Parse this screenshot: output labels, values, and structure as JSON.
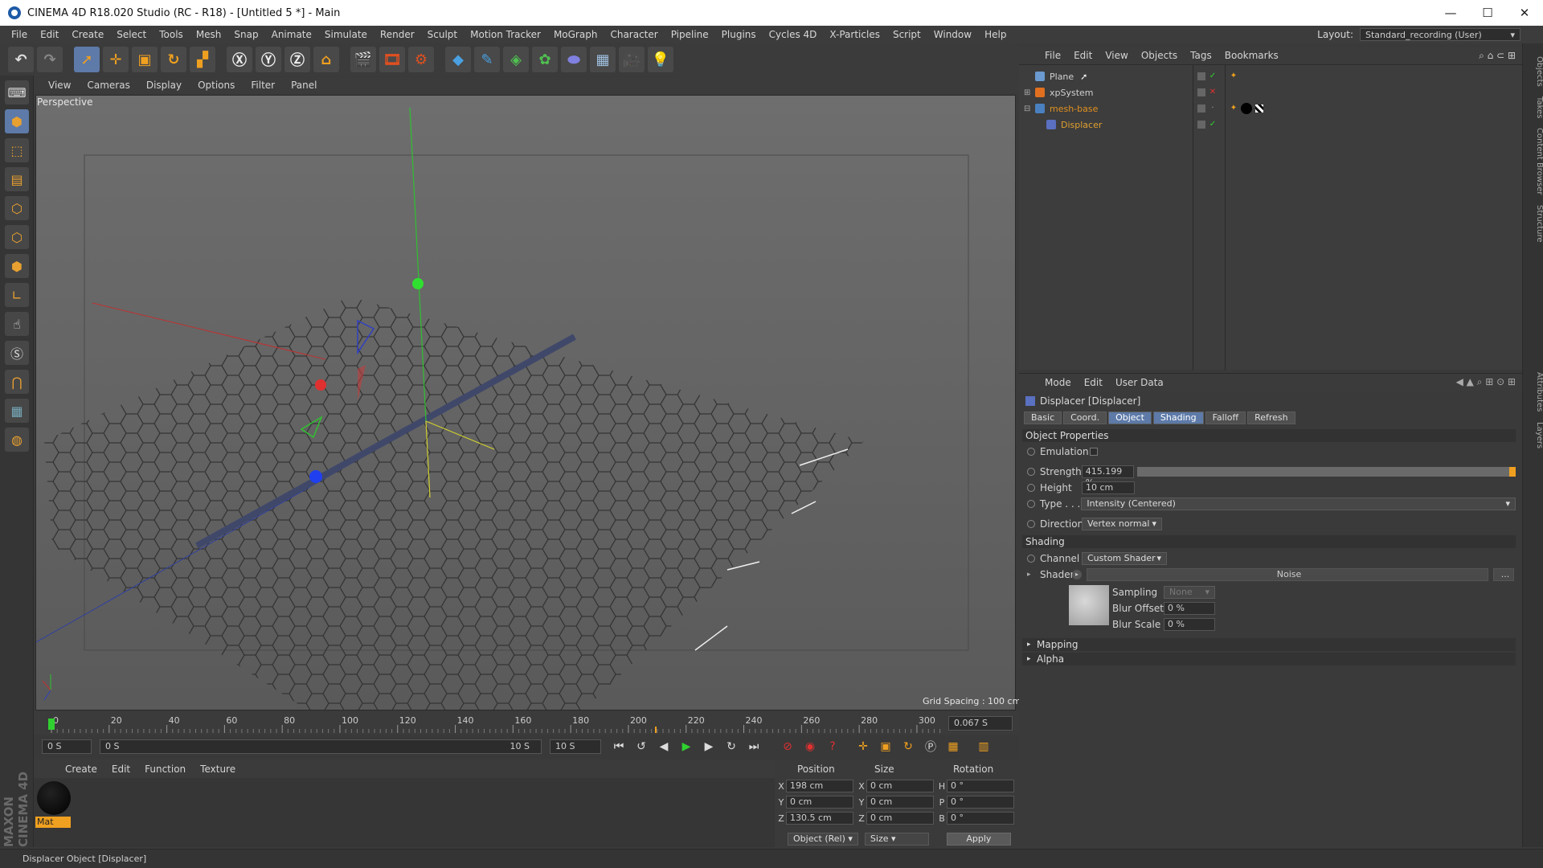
{
  "window": {
    "title": "CINEMA 4D R18.020 Studio (RC - R18) - [Untitled 5 *] - Main",
    "min": "—",
    "max": "☐",
    "close": "✕"
  },
  "menu": [
    "File",
    "Edit",
    "Create",
    "Select",
    "Tools",
    "Mesh",
    "Snap",
    "Animate",
    "Simulate",
    "Render",
    "Sculpt",
    "Motion Tracker",
    "MoGraph",
    "Character",
    "Pipeline",
    "Plugins",
    "Cycles 4D",
    "X-Particles",
    "Script",
    "Window",
    "Help"
  ],
  "layout": {
    "label": "Layout:",
    "value": "Standard_recording (User)"
  },
  "viewport": {
    "menu": [
      "View",
      "Cameras",
      "Display",
      "Options",
      "Filter",
      "Panel"
    ],
    "label": "Perspective",
    "grid_spacing": "Grid Spacing : 100 cm"
  },
  "timeline": {
    "ticks": [
      "0",
      "20",
      "40",
      "60",
      "80",
      "100",
      "120",
      "140",
      "160",
      "180",
      "200",
      "220",
      "240",
      "260",
      "280",
      "300"
    ],
    "current_frame": "0.067 S"
  },
  "transport": {
    "start": "0 S",
    "range_start": "0 S",
    "range_end": "10 S",
    "end": "10 S"
  },
  "material": {
    "menu": [
      "Create",
      "Edit",
      "Function",
      "Texture"
    ],
    "name": "Mat"
  },
  "coordinates": {
    "headers": [
      "Position",
      "Size",
      "Rotation"
    ],
    "rows": [
      {
        "pos_label": "X",
        "pos": "198 cm",
        "size_label": "X",
        "size": "0 cm",
        "rot_label": "H",
        "rot": "0 °"
      },
      {
        "pos_label": "Y",
        "pos": "0 cm",
        "size_label": "Y",
        "size": "0 cm",
        "rot_label": "P",
        "rot": "0 °"
      },
      {
        "pos_label": "Z",
        "pos": "130.5 cm",
        "size_label": "Z",
        "size": "0 cm",
        "rot_label": "B",
        "rot": "0 °"
      }
    ],
    "mode": "Object (Rel)",
    "size_mode": "Size",
    "apply": "Apply"
  },
  "status": "Displacer Object [Displacer]",
  "objects": {
    "menu": [
      "File",
      "Edit",
      "View",
      "Objects",
      "Tags",
      "Bookmarks"
    ],
    "items": [
      {
        "name": "Plane",
        "color": "#d0d0d0"
      },
      {
        "name": "xpSystem",
        "color": "#d0d0d0"
      },
      {
        "name": "mesh-base",
        "color": "#e09020"
      },
      {
        "name": "Displacer",
        "color": "#e0a030"
      }
    ]
  },
  "attributes": {
    "menu": [
      "Mode",
      "Edit",
      "User Data"
    ],
    "title": "Displacer [Displacer]",
    "tabs": [
      "Basic",
      "Coord.",
      "Object",
      "Shading",
      "Falloff",
      "Refresh"
    ],
    "active_tabs": [
      "Object",
      "Shading"
    ],
    "object_properties": "Object Properties",
    "emulation": "Emulation",
    "strength_label": "Strength",
    "strength_value": "415.199 %",
    "strength_fraction": 1.0,
    "height_label": "Height",
    "height_value": "10 cm",
    "type_label": "Type . . .",
    "type_value": "Intensity (Centered)",
    "direction_label": "Direction",
    "direction_value": "Vertex normal",
    "shading_section": "Shading",
    "channel_label": "Channel",
    "channel_value": "Custom Shader",
    "shader_label": "Shader",
    "shader_value": "Noise",
    "shader_more": "...",
    "sampling_label": "Sampling",
    "sampling_value": "None",
    "blur_offset_label": "Blur Offset",
    "blur_offset_value": "0 %",
    "blur_scale_label": "Blur Scale",
    "blur_scale_value": "0 %",
    "mapping": "Mapping",
    "alpha": "Alpha"
  },
  "right_tabs": [
    "Objects",
    "Takes",
    "Content Browser",
    "Structure",
    "Attributes",
    "Layers"
  ]
}
